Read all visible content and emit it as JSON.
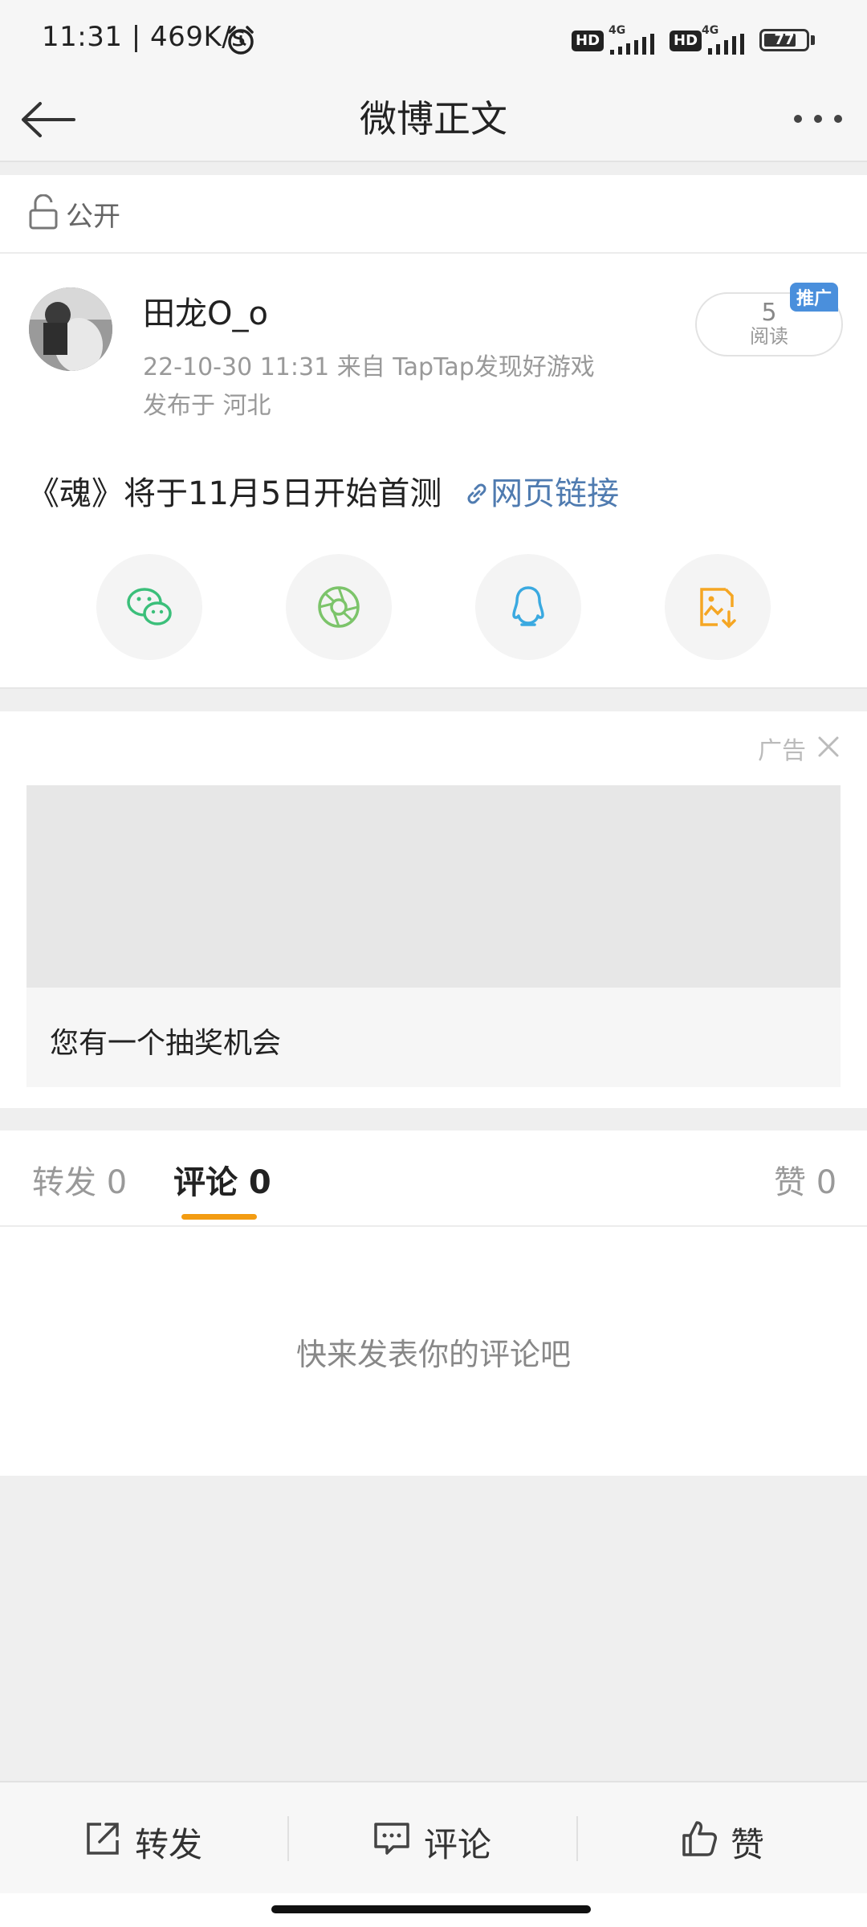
{
  "status_bar": {
    "time": "11:31 | 469K/s",
    "hd1": "HD",
    "net1": "4G",
    "hd2": "HD",
    "net2": "4G",
    "battery": "77",
    "battery_level_percent": 77
  },
  "nav": {
    "title": "微博正文",
    "back_icon": "arrow-left-icon",
    "more_icon": "more-horizontal-icon"
  },
  "visibility": {
    "label": "公开",
    "icon": "unlock-icon"
  },
  "post": {
    "author": "田龙O_o",
    "meta": "22-10-30 11:31  来自 TapTap发现好游戏",
    "location": "发布于 河北",
    "read_count": "5",
    "read_label": "阅读",
    "promo_tag": "推广",
    "text": "《魂》将于11月5日开始首测",
    "link_label": "网页链接",
    "share_buttons": [
      {
        "name": "wechat-icon",
        "color": "#3bbf7a"
      },
      {
        "name": "moments-icon",
        "color": "#7cc46a"
      },
      {
        "name": "qq-icon",
        "color": "#3aa9e0"
      },
      {
        "name": "save-image-icon",
        "color": "#f5a623"
      }
    ]
  },
  "ad": {
    "label": "广告",
    "caption": "您有一个抽奖机会"
  },
  "tabs": [
    {
      "label": "转发 0",
      "active": false
    },
    {
      "label": "评论 0",
      "active": true
    },
    {
      "label": "赞 0",
      "active": false
    }
  ],
  "comments": {
    "empty_text": "快来发表你的评论吧"
  },
  "bottom_bar": {
    "repost": "转发",
    "comment": "评论",
    "like": "赞"
  },
  "colors": {
    "accent": "#f39c12",
    "link": "#4f7bb0",
    "promo": "#4a8fdc"
  }
}
